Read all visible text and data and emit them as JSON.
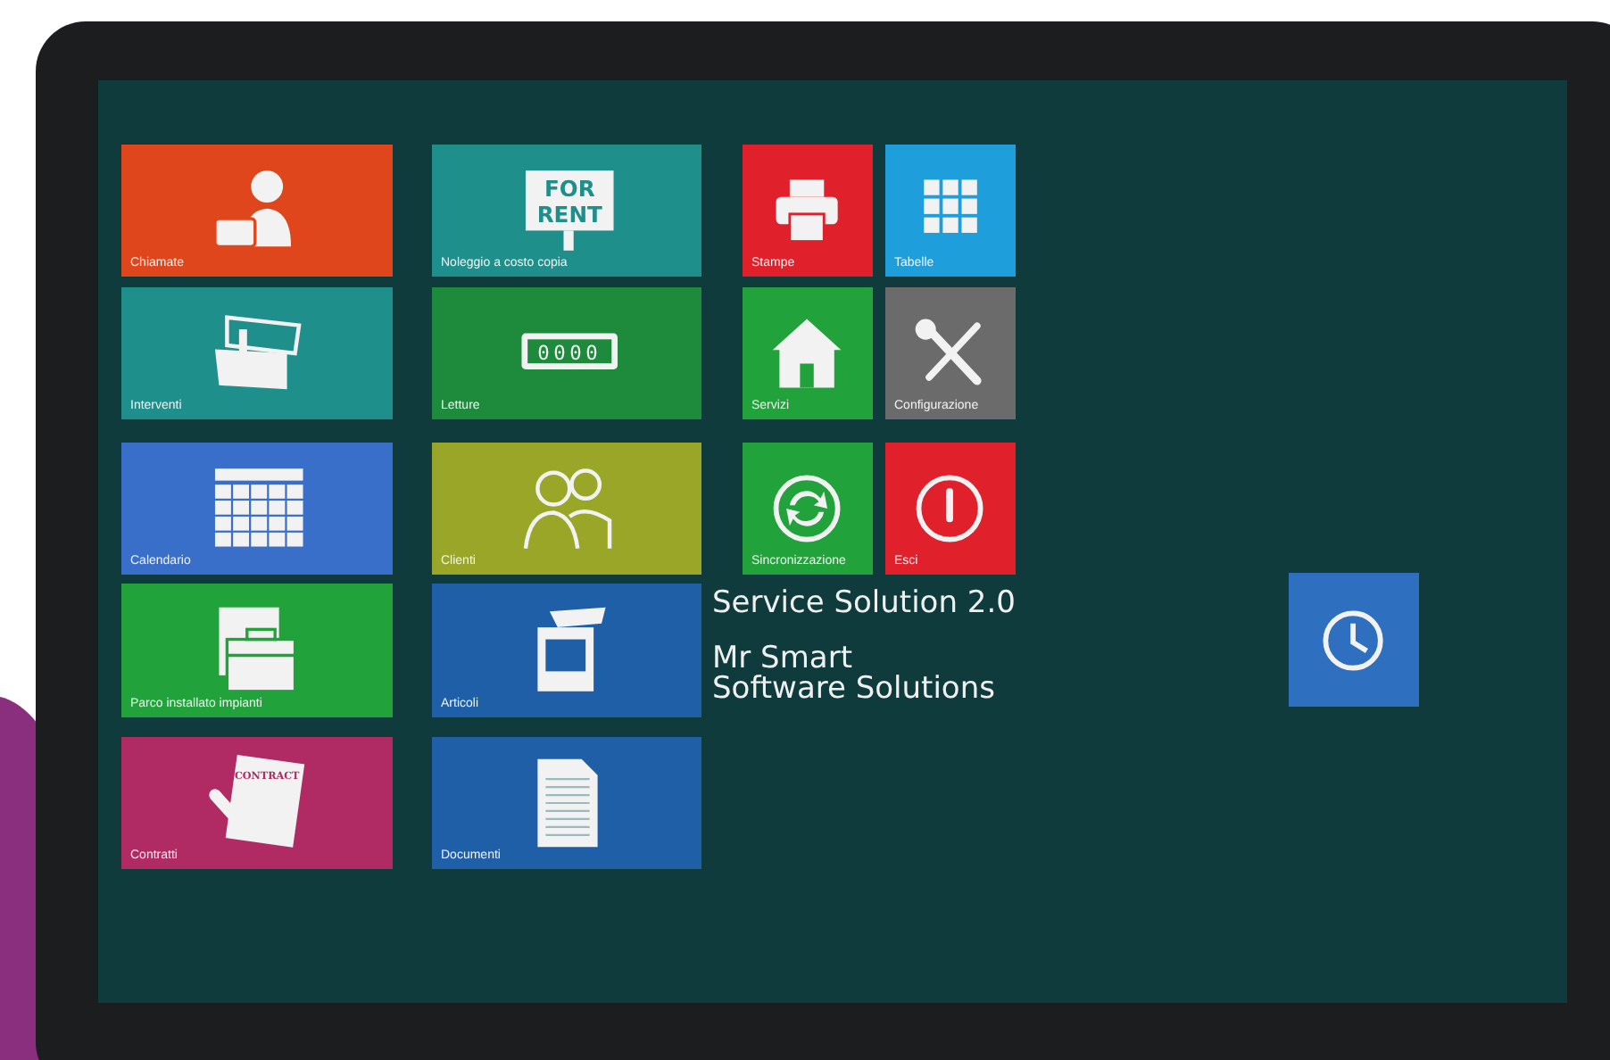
{
  "tiles": [
    {
      "label": "Chiamate",
      "color": "#e0461b",
      "kind": "operator"
    },
    {
      "label": "Noleggio a costo copia",
      "color": "#1f8f8c",
      "kind": "sign",
      "icon_text": [
        "FOR",
        "RENT"
      ]
    },
    {
      "label": "Stampe",
      "color": "#e0202b",
      "kind": "printer"
    },
    {
      "label": "Tabelle",
      "color": "#1e9fdc",
      "kind": "grid"
    },
    {
      "label": "Interventi",
      "color": "#1f8f8c",
      "kind": "toolbox"
    },
    {
      "label": "Letture",
      "color": "#1d8a3c",
      "kind": "counter",
      "icon_text": [
        "0000"
      ]
    },
    {
      "label": "Servizi",
      "color": "#21a23a",
      "kind": "house"
    },
    {
      "label": "Configurazione",
      "color": "#6b6b6b",
      "kind": "tools"
    },
    {
      "label": "Calendario",
      "color": "#3a6fc9",
      "kind": "calendar"
    },
    {
      "label": "Clienti",
      "color": "#9aa627",
      "kind": "people"
    },
    {
      "label": "Sincronizzazione",
      "color": "#21a23a",
      "kind": "sync"
    },
    {
      "label": "Esci",
      "color": "#e0202b",
      "kind": "power"
    },
    {
      "label": "Parco installato impianti",
      "color": "#21a23a",
      "kind": "case"
    },
    {
      "label": "Articoli",
      "color": "#1f5fa8",
      "kind": "box"
    },
    {
      "label": "Contratti",
      "color": "#b02a63",
      "kind": "contract",
      "icon_text": [
        "CONTRACT"
      ]
    },
    {
      "label": "Documenti",
      "color": "#1f5fa8",
      "kind": "document"
    },
    {
      "color": "#2f6fc0",
      "kind": "history"
    }
  ],
  "product": {
    "name": "Service Solution 2.0",
    "company": [
      "Mr Smart",
      "Software Solutions"
    ]
  }
}
